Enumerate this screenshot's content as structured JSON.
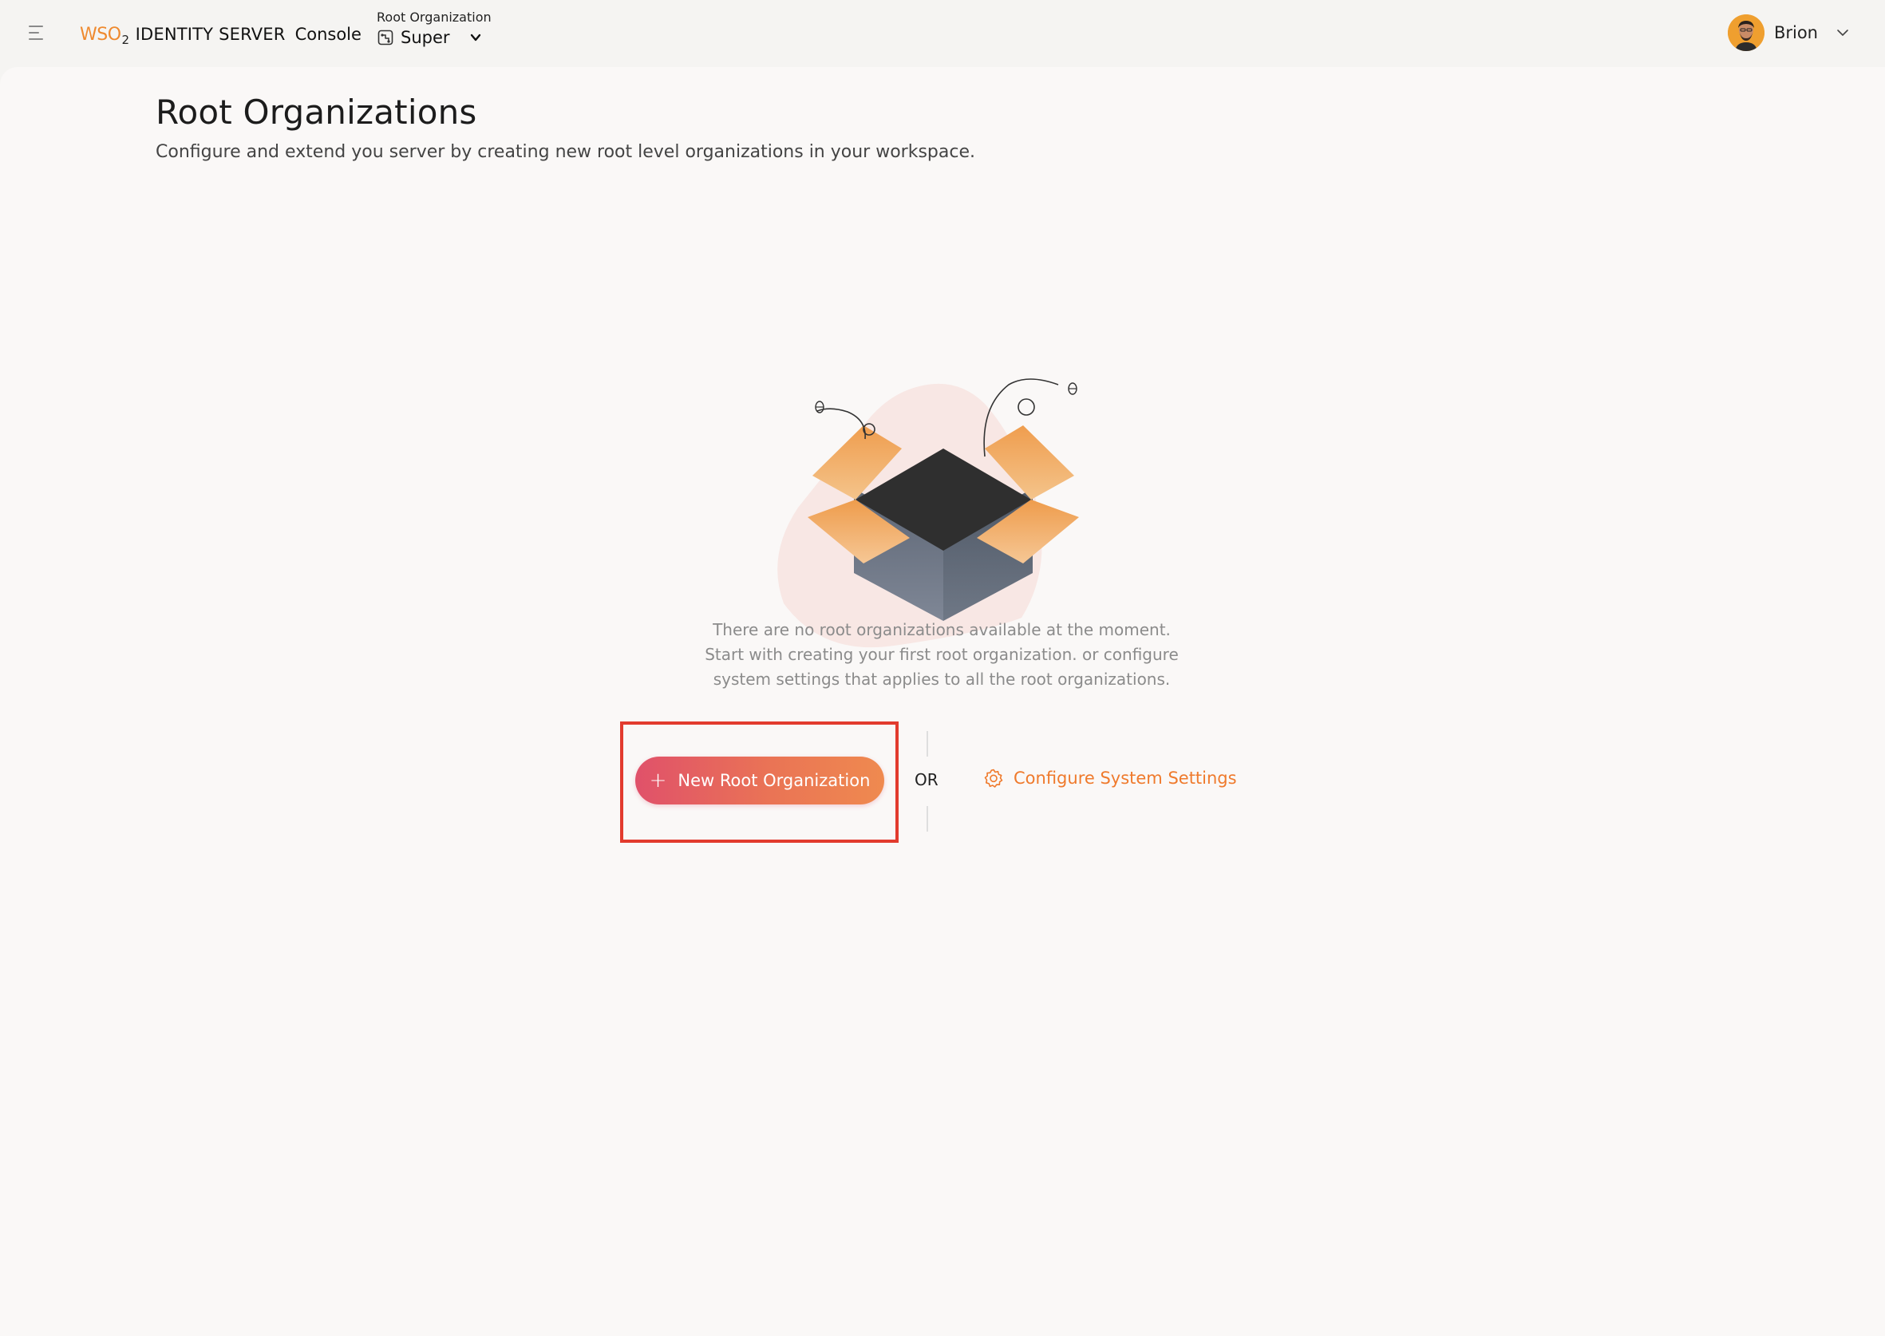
{
  "header": {
    "brand_logo_text": "WSO",
    "brand_logo_sub": "2",
    "brand_product": "IDENTITY SERVER",
    "brand_console": "Console",
    "org_switcher": {
      "label": "Root Organization",
      "current": "Super"
    },
    "user": {
      "name": "Brion"
    }
  },
  "main": {
    "title": "Root Organizations",
    "description": "Configure and extend you server by creating new root level organizations in your workspace.",
    "empty_state": {
      "line1": "There are no root organizations available at the moment.",
      "line2": "Start with creating your first root organization. or configure",
      "line3": "system settings that applies to all the root organizations."
    },
    "actions": {
      "new_button_label": "New Root Organization",
      "or_text": "OR",
      "configure_link_label": "Configure System Settings"
    }
  },
  "colors": {
    "accent": "#ef7a2c",
    "button_gradient_start": "#e0516a",
    "button_gradient_end": "#ef8a4f",
    "highlight_box": "#e23b2e",
    "background": "#faf8f7"
  },
  "icons": {
    "menu": "hamburger-icon",
    "org": "organization-icon",
    "caret": "chevron-down-icon",
    "plus": "plus-icon",
    "gear": "gear-icon"
  }
}
